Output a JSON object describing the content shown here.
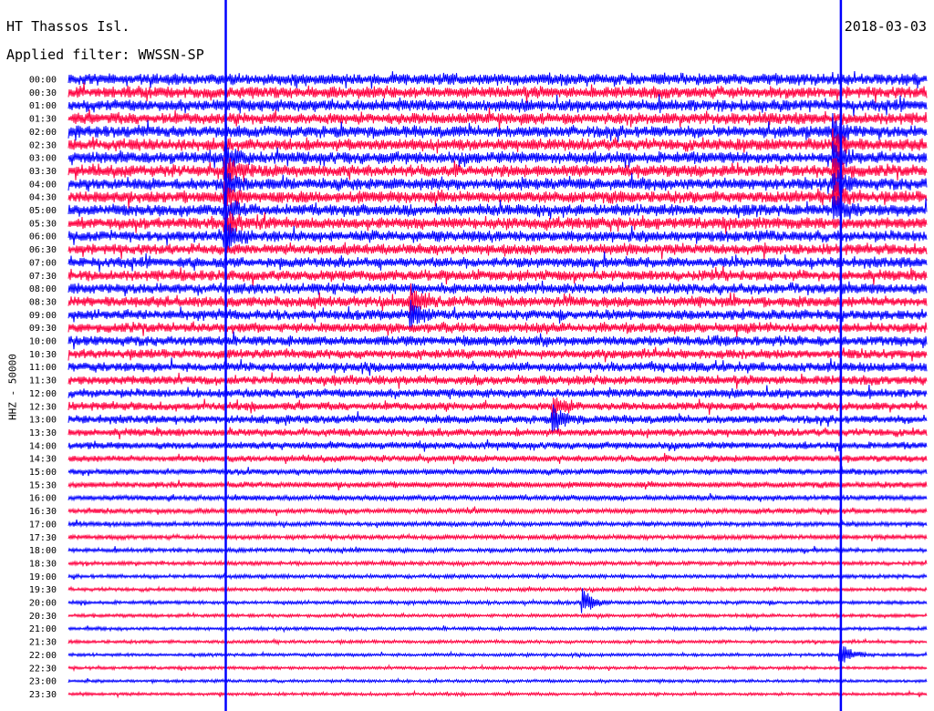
{
  "header": {
    "station": "HT Thassos Isl.",
    "filter": "Applied filter: WWSSN-SP",
    "date": "2018-03-03"
  },
  "chart_data": {
    "type": "line",
    "title": "HT Thassos Isl.",
    "ylabel": "HHZ - 50000",
    "date": "2018-03-03",
    "filter": "WWSSN-SP",
    "rows": [
      "00:00",
      "00:30",
      "01:00",
      "01:30",
      "02:00",
      "02:30",
      "03:00",
      "03:30",
      "04:00",
      "04:30",
      "05:00",
      "05:30",
      "06:00",
      "06:30",
      "07:00",
      "07:30",
      "08:00",
      "08:30",
      "09:00",
      "09:30",
      "10:00",
      "10:30",
      "11:00",
      "11:30",
      "12:00",
      "12:30",
      "13:00",
      "13:30",
      "14:00",
      "14:30",
      "15:00",
      "15:30",
      "16:00",
      "16:30",
      "17:00",
      "17:30",
      "18:00",
      "18:30",
      "19:00",
      "19:30",
      "20:00",
      "20:30",
      "21:00",
      "21:30",
      "22:00",
      "22:30",
      "23:00",
      "23:30"
    ],
    "trace_colors": [
      "#0000ff",
      "#ff0040"
    ],
    "noise_amplitude": [
      1.0,
      1.0,
      1.0,
      1.0,
      1.0,
      1.0,
      1.0,
      1.0,
      1.0,
      1.0,
      1.0,
      1.0,
      0.95,
      0.9,
      0.9,
      0.9,
      0.9,
      0.9,
      0.85,
      0.85,
      0.85,
      0.8,
      0.8,
      0.8,
      0.75,
      0.7,
      0.7,
      0.65,
      0.6,
      0.55,
      0.5,
      0.5,
      0.45,
      0.42,
      0.4,
      0.38,
      0.35,
      0.33,
      0.32,
      0.3,
      0.3,
      0.28,
      0.28,
      0.27,
      0.26,
      0.26,
      0.25,
      0.25
    ],
    "events": [
      {
        "start": "00:00",
        "end": "23:59",
        "minute": 5.5,
        "type": "spike-line"
      },
      {
        "start": "00:00",
        "end": "23:59",
        "minute": 27.0,
        "type": "spike-line"
      },
      {
        "start": "03:00",
        "end": "06:00",
        "minute": 5.5,
        "type": "burst"
      },
      {
        "start": "02:00",
        "end": "05:00",
        "minute": 26.8,
        "type": "burst"
      },
      {
        "start": "08:30",
        "end": "09:00",
        "minute": 12.0,
        "type": "burst"
      },
      {
        "start": "12:30",
        "end": "13:00",
        "minute": 17.0,
        "type": "burst"
      },
      {
        "start": "20:00",
        "end": "20:00",
        "minute": 18.0,
        "type": "burst"
      },
      {
        "start": "22:00",
        "end": "22:00",
        "minute": 27.0,
        "type": "burst"
      }
    ],
    "grid": false,
    "legend": "none"
  }
}
